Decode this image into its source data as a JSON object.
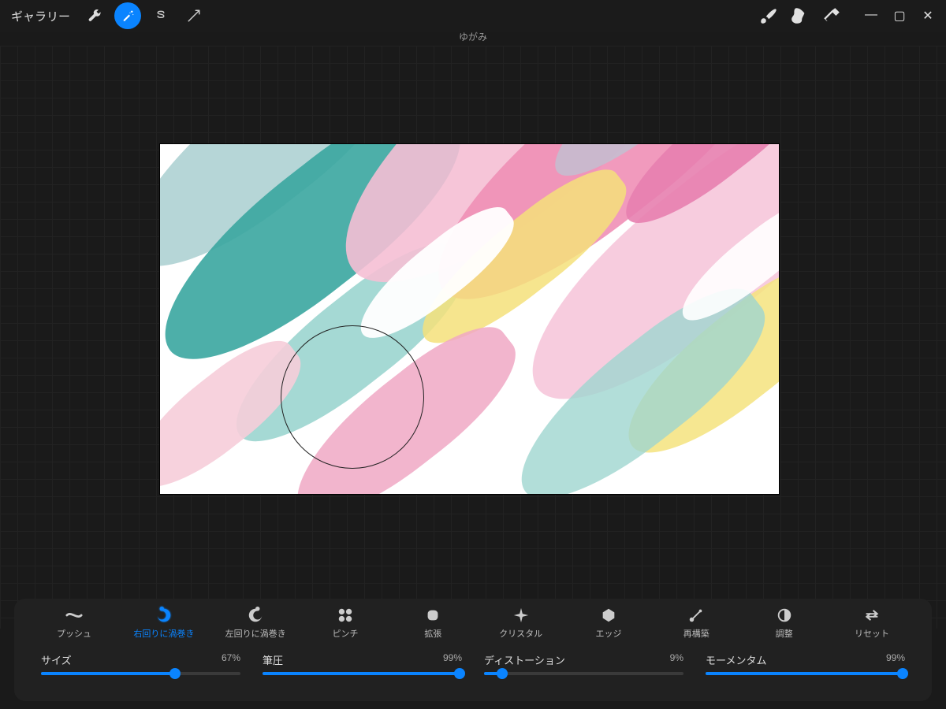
{
  "topbar": {
    "gallery_label": "ギャラリー",
    "subtitle": "ゆがみ",
    "icons": {
      "wrench": "wrench-icon",
      "wand": "wand-icon",
      "s": "s-icon",
      "arrow": "arrow-icon",
      "brush": "brush-icon",
      "smudge": "smudge-icon",
      "eraser": "eraser-icon"
    }
  },
  "window_controls": {
    "min": "—",
    "max": "▢",
    "close": "✕"
  },
  "modes": [
    {
      "id": "push",
      "label": "プッシュ",
      "active": false
    },
    {
      "id": "twirl_r",
      "label": "右回りに渦巻き",
      "active": true
    },
    {
      "id": "twirl_l",
      "label": "左回りに渦巻き",
      "active": false
    },
    {
      "id": "pinch",
      "label": "ピンチ",
      "active": false
    },
    {
      "id": "expand",
      "label": "拡張",
      "active": false
    },
    {
      "id": "crystal",
      "label": "クリスタル",
      "active": false
    },
    {
      "id": "edge",
      "label": "エッジ",
      "active": false
    },
    {
      "id": "rebuild",
      "label": "再構築",
      "active": false
    },
    {
      "id": "adjust",
      "label": "調整",
      "active": false
    },
    {
      "id": "reset",
      "label": "リセット",
      "active": false
    }
  ],
  "sliders": {
    "size": {
      "label": "サイズ",
      "value": 67,
      "display": "67%"
    },
    "pressure": {
      "label": "筆圧",
      "value": 99,
      "display": "99%"
    },
    "distortion": {
      "label": "ディストーション",
      "value": 9,
      "display": "9%"
    },
    "momentum": {
      "label": "モーメンタム",
      "value": 99,
      "display": "99%"
    }
  },
  "colors": {
    "accent": "#0a84ff"
  }
}
